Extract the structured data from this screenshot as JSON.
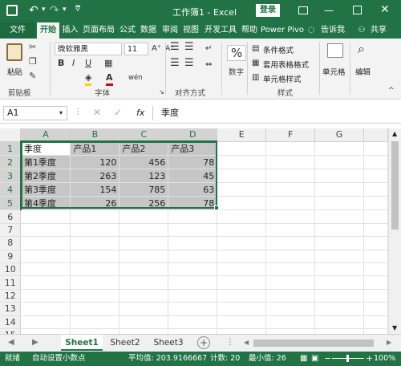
{
  "title_bar": {
    "document_title": "工作簿1 - Excel",
    "login_label": "登录",
    "restore_icon": "restore-icon",
    "minimize_icon": "minimize-icon",
    "maximize_icon": "maximize-icon",
    "close_icon": "close-icon"
  },
  "ribbon_tabs": {
    "file": "文件",
    "home": "开始",
    "insert": "插入",
    "layout": "页面布局",
    "formulas": "公式",
    "data": "数据",
    "review": "审阅",
    "view": "视图",
    "developer": "开发工具",
    "help": "帮助",
    "power_pivot": "Power Pivo",
    "tell_me": "告诉我",
    "share": "共享"
  },
  "ribbon": {
    "clipboard": {
      "paste": "粘贴",
      "label": "剪贴板"
    },
    "font": {
      "name": "微软雅黑",
      "size": "11",
      "bold": "B",
      "italic": "I",
      "underline": "U",
      "font_color_a": "A",
      "wen": "wén",
      "label": "字体"
    },
    "alignment": {
      "label": "对齐方式"
    },
    "number": {
      "percent": "%",
      "label": "数字"
    },
    "styles": {
      "conditional": "条件格式",
      "table": "套用表格格式",
      "cell": "单元格样式",
      "label": "样式"
    },
    "cells": {
      "label": "单元格"
    },
    "editing": {
      "label": "编辑"
    }
  },
  "formula_bar": {
    "name_box": "A1",
    "fx": "fx",
    "formula": "季度"
  },
  "sheet": {
    "columns": [
      "A",
      "B",
      "C",
      "D",
      "E",
      "F",
      "G"
    ],
    "rows": [
      [
        "季度",
        "产品1",
        "产品2",
        "产品3"
      ],
      [
        "第1季度",
        "120",
        "456",
        "78"
      ],
      [
        "第2季度",
        "263",
        "123",
        "45"
      ],
      [
        "第3季度",
        "154",
        "785",
        "63"
      ],
      [
        "第4季度",
        "26",
        "256",
        "78"
      ],
      [],
      [],
      [],
      [],
      [],
      [],
      [],
      [],
      [],
      []
    ]
  },
  "sheet_tabs": [
    "Sheet1",
    "Sheet2",
    "Sheet3"
  ],
  "status_bar": {
    "ready": "就绪",
    "auto_decimal": "自动设置小数点",
    "average": "平均值: 203.9166667",
    "count": "计数: 20",
    "min": "最小值: 26",
    "zoom": "100%"
  },
  "colors": {
    "excel_green": "#217346",
    "selection_gray": "#c6c6c6"
  }
}
